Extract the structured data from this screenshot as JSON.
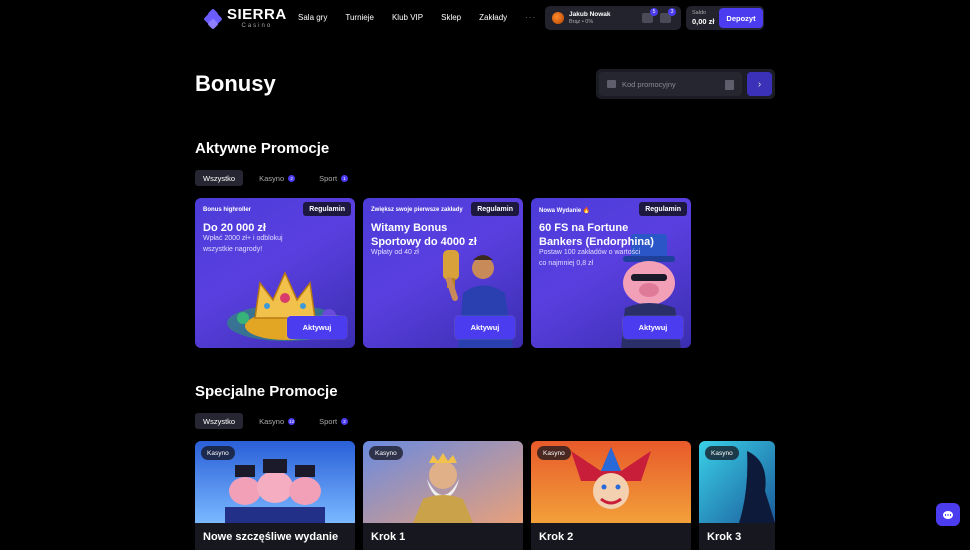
{
  "header": {
    "logo_title": "SIERRA",
    "logo_sub": "Casino",
    "nav": [
      "Sala gry",
      "Turnieje",
      "Klub VIP",
      "Sklep",
      "Zakłady"
    ],
    "more": "···",
    "user": {
      "name": "Jakub Nowak",
      "level": "Brąz • 0%"
    },
    "icon_badges": [
      "5",
      "3"
    ],
    "balance_label": "Saldo",
    "balance_value": "0,00 zł",
    "deposit_label": "Depozyt"
  },
  "page": {
    "title": "Bonusy",
    "promo_placeholder": "Kod promocyjny"
  },
  "active": {
    "title": "Aktywne Promocje",
    "tabs": [
      {
        "label": "Wszystko",
        "count": ""
      },
      {
        "label": "Kasyno",
        "count": "2"
      },
      {
        "label": "Sport",
        "count": "1"
      }
    ],
    "cards": [
      {
        "tag": "Bonus highroller",
        "rules": "Regulamin",
        "title": "Do 20 000 zł",
        "desc": "Wpłać 2000 zł+ i odblokuj wszystkie nagrody!",
        "button": "Aktywuj"
      },
      {
        "tag": "Zwiększ swoje pierwsze zakłady",
        "rules": "Regulamin",
        "title": "Witamy Bonus Sportowy do 4000 zł",
        "desc": "Wpłaty od 40 zł",
        "button": "Aktywuj"
      },
      {
        "tag": "Nowa Wydanie 🔥",
        "rules": "Regulamin",
        "title": "60 FS na Fortune Bankers (Endorphina)",
        "desc": "Postaw 100 zakładów o wartości co najmniej 0,8 zł",
        "button": "Aktywuj"
      }
    ]
  },
  "special": {
    "title": "Specjalne Promocje",
    "tabs": [
      {
        "label": "Wszystko",
        "count": ""
      },
      {
        "label": "Kasyno",
        "count": "12"
      },
      {
        "label": "Sport",
        "count": "2"
      }
    ],
    "cards": [
      {
        "tag": "Kasyno",
        "title": "Nowe szczęśliwe wydanie"
      },
      {
        "tag": "Kasyno",
        "title": "Krok 1"
      },
      {
        "tag": "Kasyno",
        "title": "Krok 2"
      },
      {
        "tag": "Kasyno",
        "title": "Krok 3"
      }
    ]
  },
  "colors": {
    "accent": "#4b3cf0",
    "card": "#5a3fe0",
    "background": "#000000"
  }
}
